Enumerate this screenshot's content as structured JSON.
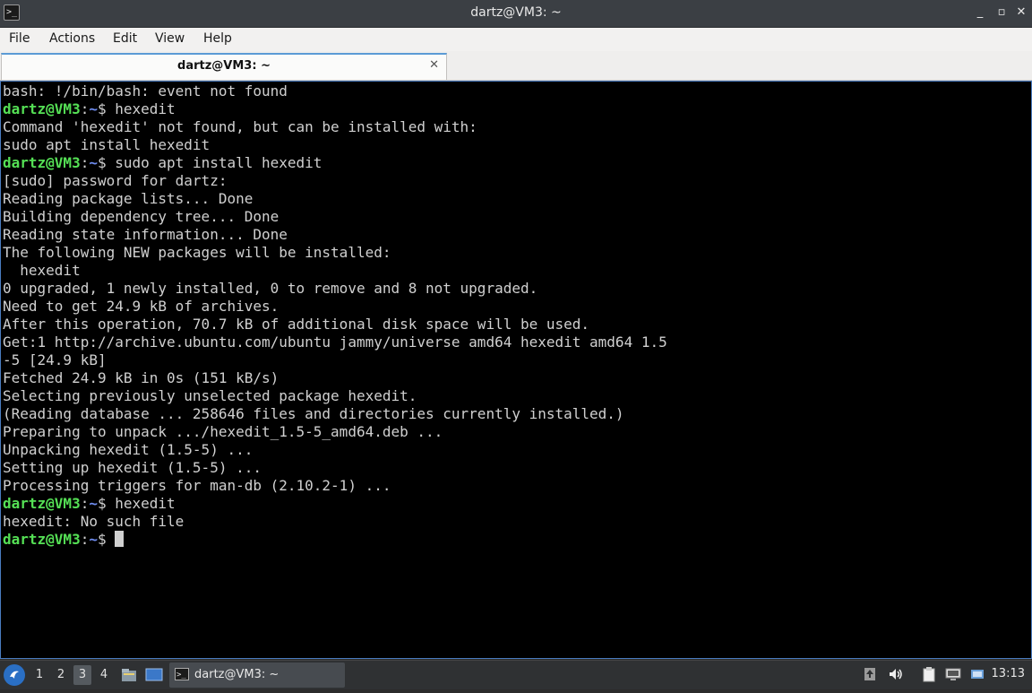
{
  "window": {
    "title": "dartz@VM3: ~",
    "controls": {
      "minimize": "_",
      "maximize": "▫",
      "close": "✕"
    }
  },
  "menu": {
    "items": [
      "File",
      "Actions",
      "Edit",
      "View",
      "Help"
    ]
  },
  "tabs": [
    {
      "label": "dartz@VM3: ~",
      "close": "✕"
    }
  ],
  "terminal": {
    "prompt": {
      "user": "dartz@VM3",
      "sep": ":",
      "path": "~",
      "sym": "$ "
    },
    "lines": [
      {
        "text": "bash: !/bin/bash: event not found"
      },
      {
        "prompt": true,
        "text": "hexedit"
      },
      {
        "text": "Command 'hexedit' not found, but can be installed with:"
      },
      {
        "text": "sudo apt install hexedit"
      },
      {
        "prompt": true,
        "text": "sudo apt install hexedit"
      },
      {
        "text": "[sudo] password for dartz:"
      },
      {
        "text": "Reading package lists... Done"
      },
      {
        "text": "Building dependency tree... Done"
      },
      {
        "text": "Reading state information... Done"
      },
      {
        "text": "The following NEW packages will be installed:"
      },
      {
        "text": "  hexedit"
      },
      {
        "text": "0 upgraded, 1 newly installed, 0 to remove and 8 not upgraded."
      },
      {
        "text": "Need to get 24.9 kB of archives."
      },
      {
        "text": "After this operation, 70.7 kB of additional disk space will be used."
      },
      {
        "text": "Get:1 http://archive.ubuntu.com/ubuntu jammy/universe amd64 hexedit amd64 1.5"
      },
      {
        "text": "-5 [24.9 kB]"
      },
      {
        "text": "Fetched 24.9 kB in 0s (151 kB/s)"
      },
      {
        "text": "Selecting previously unselected package hexedit."
      },
      {
        "text": "(Reading database ... 258646 files and directories currently installed.)"
      },
      {
        "text": "Preparing to unpack .../hexedit_1.5-5_amd64.deb ..."
      },
      {
        "text": "Unpacking hexedit (1.5-5) ..."
      },
      {
        "text": "Setting up hexedit (1.5-5) ..."
      },
      {
        "text": "Processing triggers for man-db (2.10.2-1) ..."
      },
      {
        "prompt": true,
        "text": "hexedit"
      },
      {
        "text": "hexedit: No such file"
      },
      {
        "prompt": true,
        "text": "",
        "cursor": true
      }
    ]
  },
  "taskbar": {
    "start_icon": "start-menu-icon",
    "desktops": [
      {
        "label": "1",
        "active": false
      },
      {
        "label": "2",
        "active": false
      },
      {
        "label": "3",
        "active": true
      },
      {
        "label": "4",
        "active": false
      }
    ],
    "task": {
      "label": "dartz@VM3: ~"
    },
    "tray_icons": [
      "upload-icon",
      "volume-icon",
      "clipboard-icon",
      "network-icon",
      "notification-icon"
    ],
    "clock": "13:13"
  }
}
